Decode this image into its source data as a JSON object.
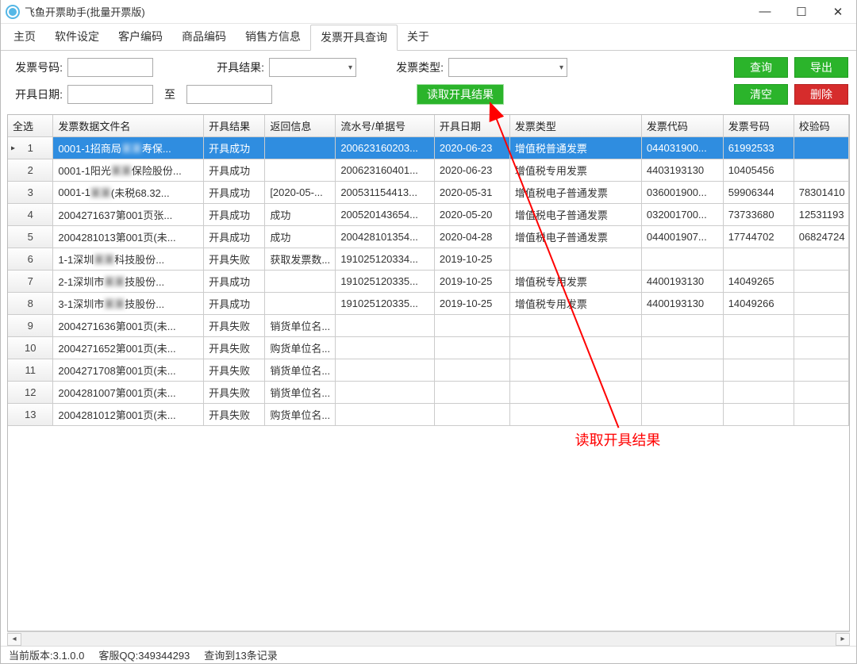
{
  "window": {
    "title": "飞鱼开票助手(批量开票版)"
  },
  "tabs": [
    "主页",
    "软件设定",
    "客户编码",
    "商品编码",
    "销售方信息",
    "发票开具查询",
    "关于"
  ],
  "activeTab": 5,
  "filters": {
    "invoiceNumberLabel": "发票号码:",
    "resultLabel": "开具结果:",
    "invoiceTypeLabel": "发票类型:",
    "dateLabel": "开具日期:",
    "toLabel": "至",
    "invoiceNumber": "",
    "dateFrom": "",
    "dateTo": ""
  },
  "buttons": {
    "query": "查询",
    "export": "导出",
    "clear": "清空",
    "delete": "删除",
    "readResult": "读取开具结果"
  },
  "table": {
    "headers": {
      "selectAll": "全选",
      "fileName": "发票数据文件名",
      "result": "开具结果",
      "returnMsg": "返回信息",
      "seq": "流水号/单据号",
      "date": "开具日期",
      "type": "发票类型",
      "code": "发票代码",
      "number": "发票号码",
      "check": "校验码"
    },
    "rows": [
      {
        "n": "1",
        "file": "0001-1招商局▇▇寿保...",
        "res": "开具成功",
        "msg": "",
        "seq": "200623160203...",
        "date": "2020-06-23",
        "type": "增值税普通发票",
        "code": "044031900...",
        "num": "61992533",
        "chk": ""
      },
      {
        "n": "2",
        "file": "0001-1阳光▇▇保险股份...",
        "res": "开具成功",
        "msg": "",
        "seq": "200623160401...",
        "date": "2020-06-23",
        "type": "增值税专用发票",
        "code": "4403193130",
        "num": "10405456",
        "chk": ""
      },
      {
        "n": "3",
        "file": "0001-1▇▇(未税68.32...",
        "res": "开具成功",
        "msg": "[2020-05-...",
        "seq": "200531154413...",
        "date": "2020-05-31",
        "type": "增值税电子普通发票",
        "code": "036001900...",
        "num": "59906344",
        "chk": "78301410"
      },
      {
        "n": "4",
        "file": "2004271637第001页张...",
        "res": "开具成功",
        "msg": "成功",
        "seq": "200520143654...",
        "date": "2020-05-20",
        "type": "增值税电子普通发票",
        "code": "032001700...",
        "num": "73733680",
        "chk": "12531193"
      },
      {
        "n": "5",
        "file": "2004281013第001页(未...",
        "res": "开具成功",
        "msg": "成功",
        "seq": "200428101354...",
        "date": "2020-04-28",
        "type": "增值税电子普通发票",
        "code": "044001907...",
        "num": "17744702",
        "chk": "06824724"
      },
      {
        "n": "6",
        "file": "1-1深圳▇▇科技股份...",
        "res": "开具失败",
        "msg": "获取发票数...",
        "seq": "191025120334...",
        "date": "2019-10-25",
        "type": "",
        "code": "",
        "num": "",
        "chk": ""
      },
      {
        "n": "7",
        "file": "2-1深圳市▇▇技股份...",
        "res": "开具成功",
        "msg": "",
        "seq": "191025120335...",
        "date": "2019-10-25",
        "type": "增值税专用发票",
        "code": "4400193130",
        "num": "14049265",
        "chk": ""
      },
      {
        "n": "8",
        "file": "3-1深圳市▇▇技股份...",
        "res": "开具成功",
        "msg": "",
        "seq": "191025120335...",
        "date": "2019-10-25",
        "type": "增值税专用发票",
        "code": "4400193130",
        "num": "14049266",
        "chk": ""
      },
      {
        "n": "9",
        "file": "2004271636第001页(未...",
        "res": "开具失败",
        "msg": "销货单位名...",
        "seq": "",
        "date": "",
        "type": "",
        "code": "",
        "num": "",
        "chk": ""
      },
      {
        "n": "10",
        "file": "2004271652第001页(未...",
        "res": "开具失败",
        "msg": "购货单位名...",
        "seq": "",
        "date": "",
        "type": "",
        "code": "",
        "num": "",
        "chk": ""
      },
      {
        "n": "11",
        "file": "2004271708第001页(未...",
        "res": "开具失败",
        "msg": "销货单位名...",
        "seq": "",
        "date": "",
        "type": "",
        "code": "",
        "num": "",
        "chk": ""
      },
      {
        "n": "12",
        "file": "2004281007第001页(未...",
        "res": "开具失败",
        "msg": "销货单位名...",
        "seq": "",
        "date": "",
        "type": "",
        "code": "",
        "num": "",
        "chk": ""
      },
      {
        "n": "13",
        "file": "2004281012第001页(未...",
        "res": "开具失败",
        "msg": "购货单位名...",
        "seq": "",
        "date": "",
        "type": "",
        "code": "",
        "num": "",
        "chk": ""
      }
    ]
  },
  "annotation": "读取开具结果",
  "status": {
    "version": "当前版本:3.1.0.0",
    "qq": "客服QQ:349344293",
    "records": "查询到13条记录"
  }
}
